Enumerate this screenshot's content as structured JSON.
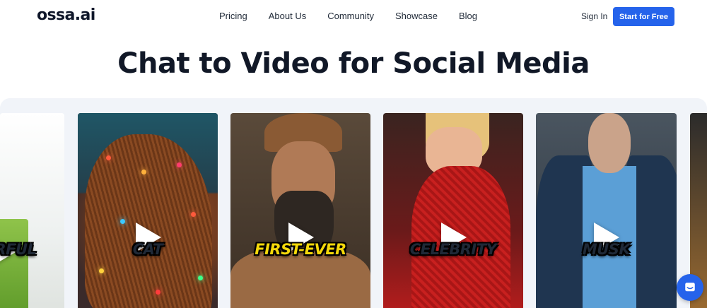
{
  "header": {
    "logo": "ossa.ai",
    "nav": [
      "Pricing",
      "About Us",
      "Community",
      "Showcase",
      "Blog"
    ],
    "sign_in": "Sign In",
    "cta": "Start for Free"
  },
  "hero": {
    "title": "Chat to Video for Social Media"
  },
  "gallery": {
    "videos": [
      {
        "caption": "RFUL",
        "caption_color": "#ffffff"
      },
      {
        "caption": "CAT",
        "caption_color": "#ffffff"
      },
      {
        "caption": "FIRST-EVER",
        "caption_color": "#f5d90a"
      },
      {
        "caption": "CELEBRITY",
        "caption_color": "#ffffff"
      },
      {
        "caption": "MUSK",
        "caption_color": "#ffffff"
      }
    ]
  },
  "colors": {
    "accent": "#2563eb",
    "gallery_bg": "#f1f4f9"
  },
  "icons": {
    "play": "play-icon",
    "chat": "chat-bubble-icon"
  }
}
